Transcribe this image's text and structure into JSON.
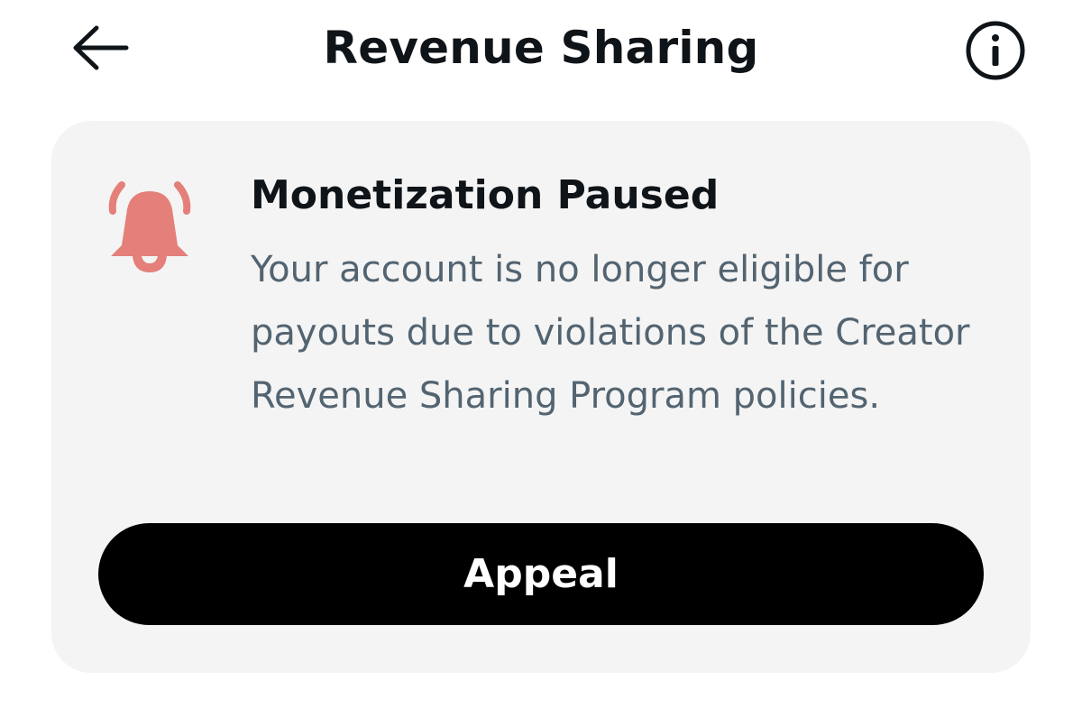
{
  "header": {
    "title": "Revenue Sharing",
    "back_icon": "arrow-left-icon",
    "info_icon": "info-circle-icon"
  },
  "notice": {
    "icon": "bell-alert-icon",
    "icon_color": "#e57f7a",
    "title": "Monetization Paused",
    "body": "Your account is no longer eligible for payouts due to violations of the Creator Revenue Sharing Program policies."
  },
  "actions": {
    "appeal_label": "Appeal"
  },
  "colors": {
    "card_background": "#f4f4f4",
    "primary_text": "#0f1419",
    "secondary_text": "#536471",
    "button_background": "#000000",
    "button_text": "#ffffff"
  }
}
